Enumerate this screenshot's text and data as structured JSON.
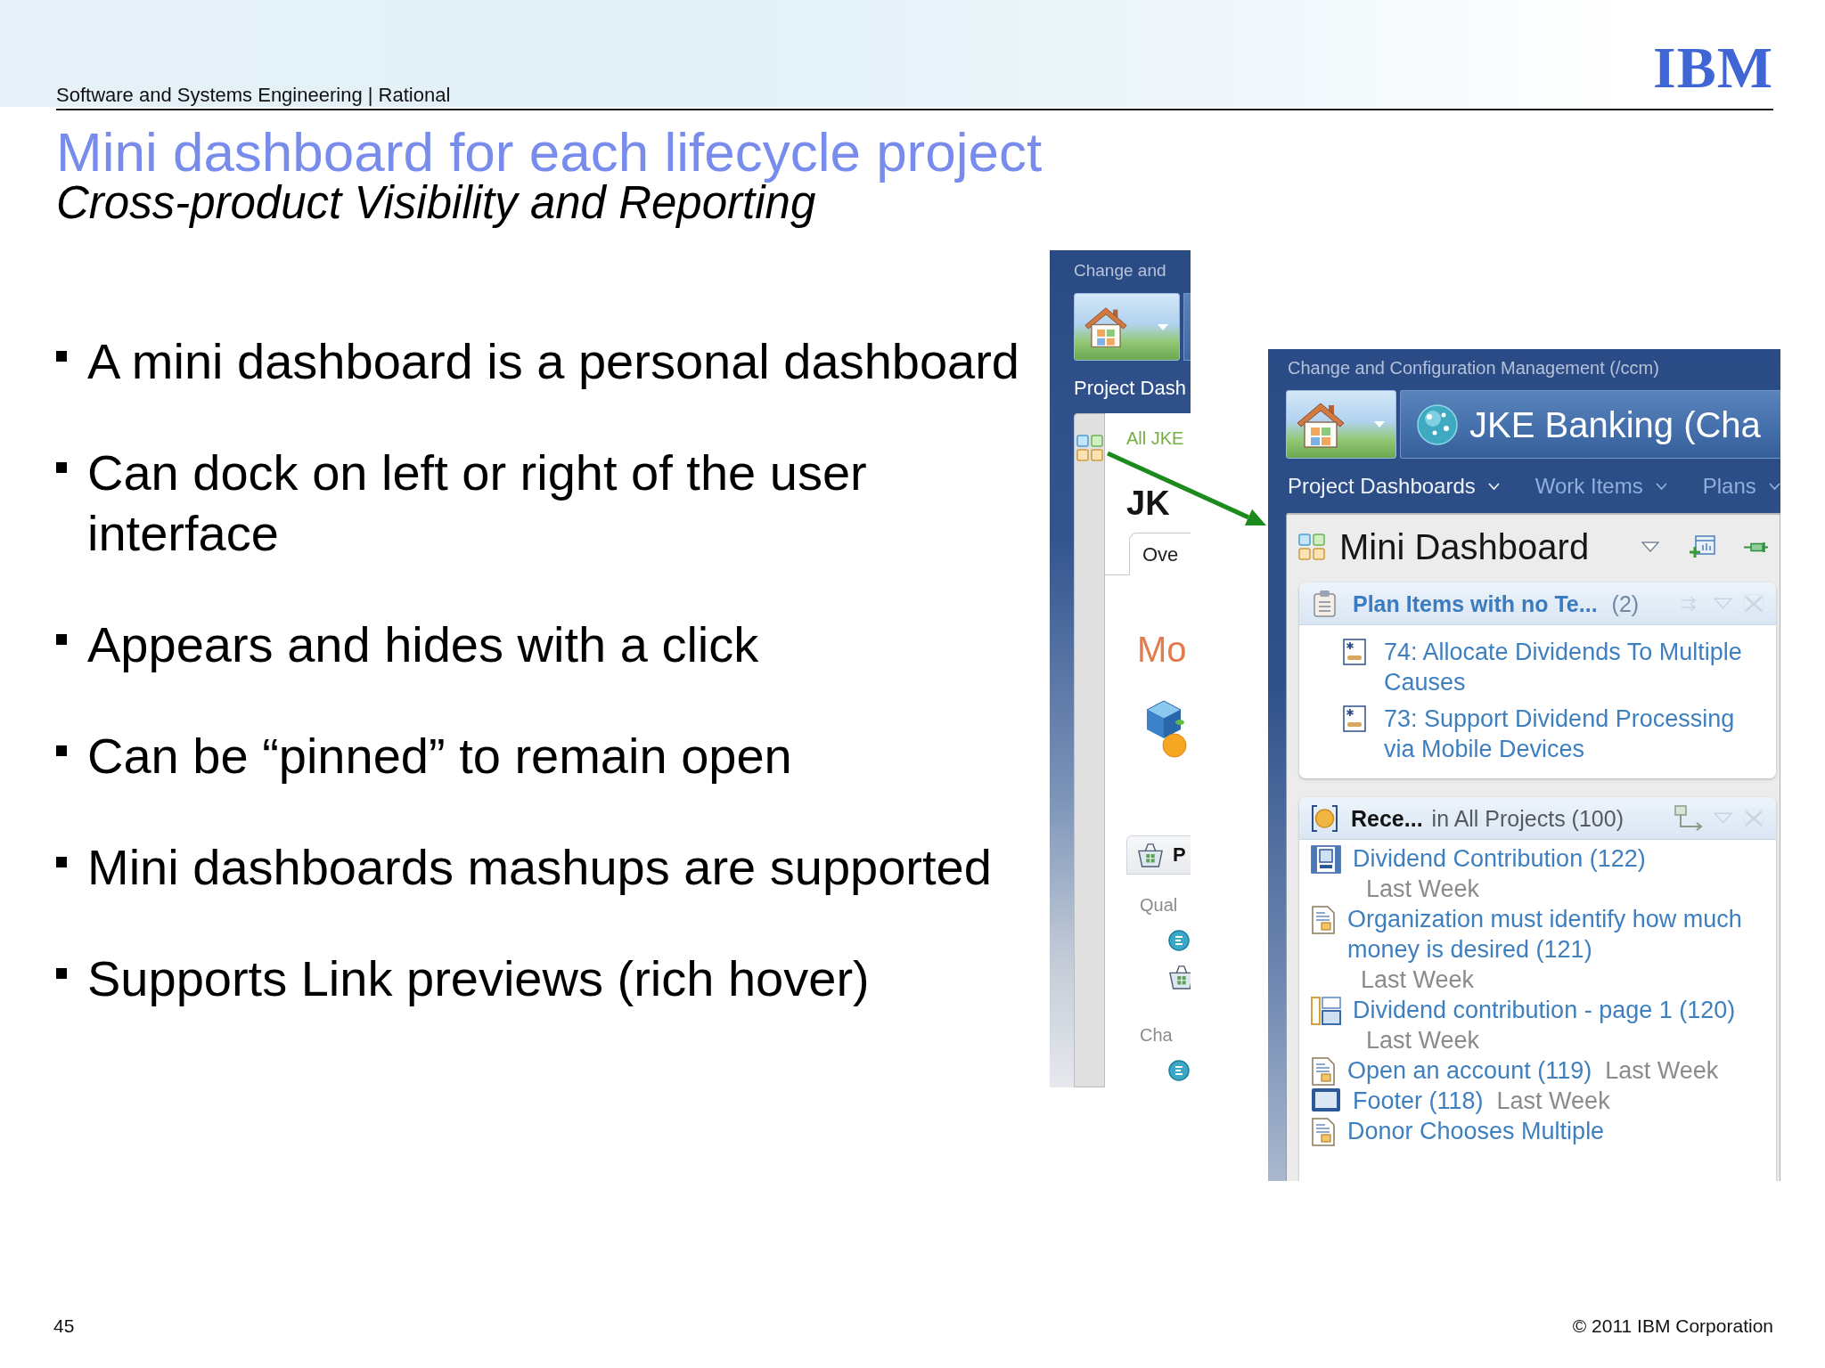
{
  "header": {
    "section": "Software and Systems Engineering | Rational",
    "logo": "IBM"
  },
  "title": "Mini dashboard for each lifecycle project",
  "subtitle": "Cross-product Visibility and Reporting",
  "bullets": [
    "A mini dashboard is a personal dashboard",
    "Can dock on left or right of the user interface",
    "Appears and hides with a click",
    "Can be “pinned” to remain open",
    "Mini dashboards mashups are supported",
    "Supports Link previews (rich hover)"
  ],
  "left_screenshot": {
    "app_title": "Change and",
    "menu_label": "Project Dash",
    "breadcrumb": "All JKE",
    "project_title": "JK",
    "tabs": [
      {
        "label": "Ove",
        "selected": true
      }
    ],
    "heading": "Mo",
    "section": {
      "title": "P",
      "groups": [
        {
          "label": "Qual",
          "entries": [
            {
              "kind": "round"
            },
            {
              "kind": "basket"
            }
          ]
        },
        {
          "label": "Cha",
          "entries": [
            {
              "kind": "round"
            }
          ]
        }
      ]
    }
  },
  "right_screenshot": {
    "app_title": "Change and Configuration Management (/ccm)",
    "project_title": "JKE Banking (Cha",
    "nav": [
      {
        "label": "Project Dashboards",
        "selected": true
      },
      {
        "label": "Work Items",
        "selected": false
      },
      {
        "label": "Plans",
        "selected": false
      }
    ],
    "mini_dashboard": {
      "title": "Mini Dashboard",
      "widgets": [
        {
          "kind": "query",
          "title": "Plan Items with no Te...",
          "suffix": "(2)",
          "items": [
            {
              "kind": "star",
              "title": "74: Allocate Dividends To Multiple Causes"
            },
            {
              "kind": "star",
              "title": "73: Support Dividend Processing via Mobile Devices"
            }
          ]
        },
        {
          "kind": "feed",
          "title": "Rece...",
          "suffix": "in All Projects (100)",
          "items": [
            {
              "kind": "film",
              "title": "Dividend Contribution (122)",
              "date": "Last Week"
            },
            {
              "kind": "page",
              "title": "Organization must identify how much money is desired (121)",
              "date": "Last Week"
            },
            {
              "kind": "layout",
              "title": "Dividend contribution - page 1 (120)",
              "date": "Last Week"
            },
            {
              "kind": "page",
              "title": "Open an account (119)",
              "date": "Last Week"
            },
            {
              "kind": "frame",
              "title": "Footer (118)",
              "date": "Last Week"
            },
            {
              "kind": "page",
              "title": "Donor Chooses Multiple"
            }
          ]
        }
      ]
    }
  },
  "footer": {
    "page": "45",
    "copyright": "© 2011 IBM Corporation"
  }
}
